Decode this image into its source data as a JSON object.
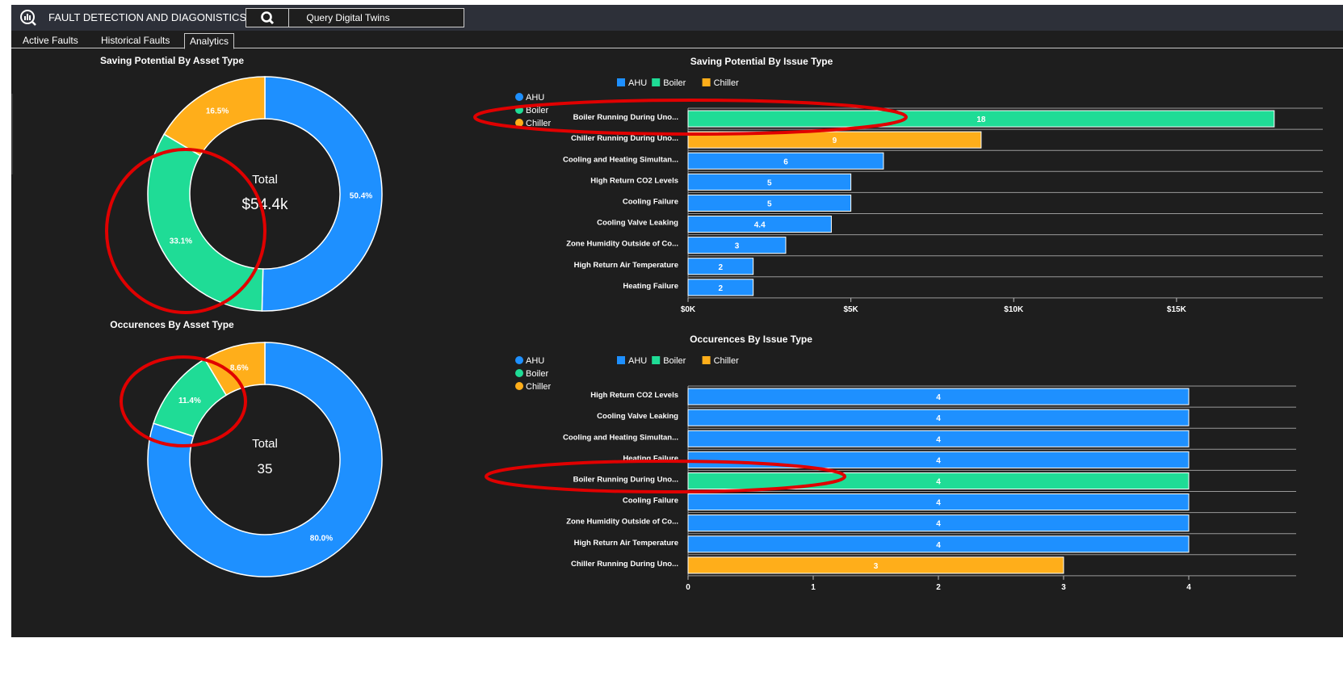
{
  "app": {
    "title": "FAULT DETECTION AND DIAGONISTICS",
    "query_button": "Query Digital Twins",
    "icons": {
      "app": "analytics-magnifier-icon",
      "search": "search-icon"
    }
  },
  "tabs": [
    {
      "label": "Active Faults",
      "active": false
    },
    {
      "label": "Historical Faults",
      "active": false
    },
    {
      "label": "Analytics",
      "active": true
    }
  ],
  "colors": {
    "AHU": "#1e90ff",
    "Boiler": "#1fdc96",
    "Chiller": "#ffae1a",
    "background": "#1e1e1e",
    "header": "#2d3039",
    "highlight_ellipse": "#e00000"
  },
  "chart_data": [
    {
      "id": "saving-by-asset",
      "type": "pie",
      "title": "Saving Potential By Asset Type",
      "center_label": "Total",
      "center_value": "$54.4k",
      "slices": [
        {
          "name": "AHU",
          "value": 50.4,
          "label": "50.4%"
        },
        {
          "name": "Boiler",
          "value": 33.1,
          "label": "33.1%"
        },
        {
          "name": "Chiller",
          "value": 16.5,
          "label": "16.5%"
        }
      ]
    },
    {
      "id": "saving-by-issue",
      "type": "bar",
      "orientation": "horizontal",
      "title": "Saving Potential By Issue Type",
      "legend": [
        "AHU",
        "Boiler",
        "Chiller"
      ],
      "side_legend": [
        "AHU",
        "Boiler",
        "Chiller"
      ],
      "categories": [
        "Boiler Running During Uno...",
        "Chiller Running During Uno...",
        "Cooling and Heating Simultan...",
        "High Return CO2 Levels",
        "Cooling Failure",
        "Cooling Valve Leaking",
        "Zone Humidity Outside of Co...",
        "High Return Air Temperature",
        "Heating Failure"
      ],
      "values": [
        18000,
        9000,
        6000,
        5000,
        5000,
        4400,
        3000,
        2000,
        2000
      ],
      "value_labels": [
        "18",
        "9",
        "6",
        "5",
        "5",
        "4.4",
        "3",
        "2",
        "2"
      ],
      "series_of_bar": [
        "Boiler",
        "Chiller",
        "AHU",
        "AHU",
        "AHU",
        "AHU",
        "AHU",
        "AHU",
        "AHU"
      ],
      "x_ticks": [
        0,
        5000,
        10000,
        15000
      ],
      "x_tick_labels": [
        "$0K",
        "$5K",
        "$10K",
        "$15K"
      ],
      "xlim": [
        0,
        18500
      ]
    },
    {
      "id": "occurences-by-asset",
      "type": "pie",
      "title": "Occurences By Asset Type",
      "center_label": "Total",
      "center_value": "35",
      "slices": [
        {
          "name": "AHU",
          "value": 80.0,
          "label": "80.0%"
        },
        {
          "name": "Boiler",
          "value": 11.4,
          "label": "11.4%"
        },
        {
          "name": "Chiller",
          "value": 8.6,
          "label": "8.6%"
        }
      ]
    },
    {
      "id": "occurences-by-issue",
      "type": "bar",
      "orientation": "horizontal",
      "title": "Occurences By Issue Type",
      "legend": [
        "AHU",
        "Boiler",
        "Chiller"
      ],
      "side_legend": [
        "AHU",
        "Boiler",
        "Chiller"
      ],
      "categories": [
        "High Return CO2 Levels",
        "Cooling Valve Leaking",
        "Cooling and Heating Simultan...",
        "Heating Failure",
        "Boiler Running During Uno...",
        "Cooling Failure",
        "Zone Humidity Outside of Co...",
        "High Return Air Temperature",
        "Chiller Running During Uno..."
      ],
      "values": [
        4,
        4,
        4,
        4,
        4,
        4,
        4,
        4,
        3
      ],
      "value_labels": [
        "4",
        "4",
        "4",
        "4",
        "4",
        "4",
        "4",
        "4",
        "3"
      ],
      "series_of_bar": [
        "AHU",
        "AHU",
        "AHU",
        "AHU",
        "Boiler",
        "AHU",
        "AHU",
        "AHU",
        "Chiller"
      ],
      "x_ticks": [
        0,
        1,
        2,
        3,
        4
      ],
      "x_tick_labels": [
        "0",
        "1",
        "2",
        "3",
        "4"
      ],
      "xlim": [
        0,
        4.6
      ]
    }
  ]
}
